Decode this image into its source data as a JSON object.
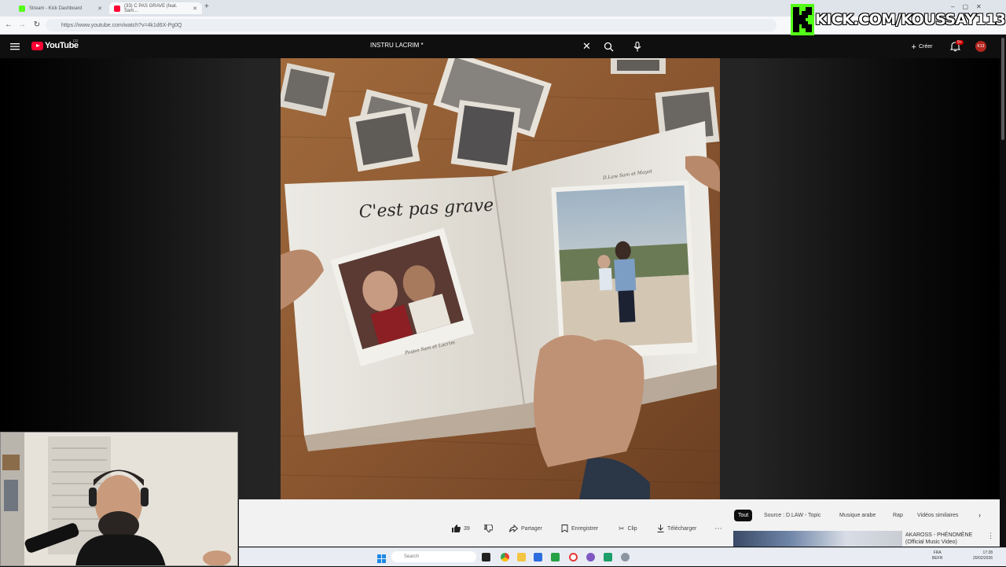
{
  "browser": {
    "tabs": [
      {
        "title": "Stream - Kick Dashboard",
        "favicon_color": "#53fc18"
      },
      {
        "title": "(33) C PAS GRAVE (feat. Sam...",
        "favicon_color": "#ff0033"
      }
    ],
    "url": "https://www.youtube.com/watch?v=4k1d6X-Pg0Q"
  },
  "youtube": {
    "logo": "YouTube",
    "country_code": "FR",
    "search_query": "INSTRU LACRIM *",
    "create_label": "Créer",
    "notif_count": "9+",
    "avatar_text": "K13"
  },
  "overlay": {
    "kick_url": "KICK.COM/KOUSSAY113"
  },
  "video": {
    "album_text": "C'est pas grave",
    "photo_captions": [
      "Paquo Sam et Lacrim",
      "D.Law Sam et Mayot"
    ]
  },
  "actions": {
    "like_count": "39",
    "share": "Partager",
    "save": "Enregistrer",
    "clip": "Clip",
    "download": "Télécharger"
  },
  "chips": [
    "Tout",
    "Source : D.LAW - Topic",
    "Musique arabe",
    "Rap",
    "Vidéos similaires"
  ],
  "next_video": {
    "title": "AKAROSS - PHÉNOMÈNE (Official Music Video)"
  },
  "taskbar": {
    "search_placeholder": "Search",
    "lang": "FRA",
    "lang_sub": "BEFR",
    "time": "17:28",
    "date": "20/02/2026"
  },
  "colors": {
    "kick_green": "#53fc18",
    "youtube_red": "#ff0033",
    "bg_dark": "#0f0f0f"
  }
}
